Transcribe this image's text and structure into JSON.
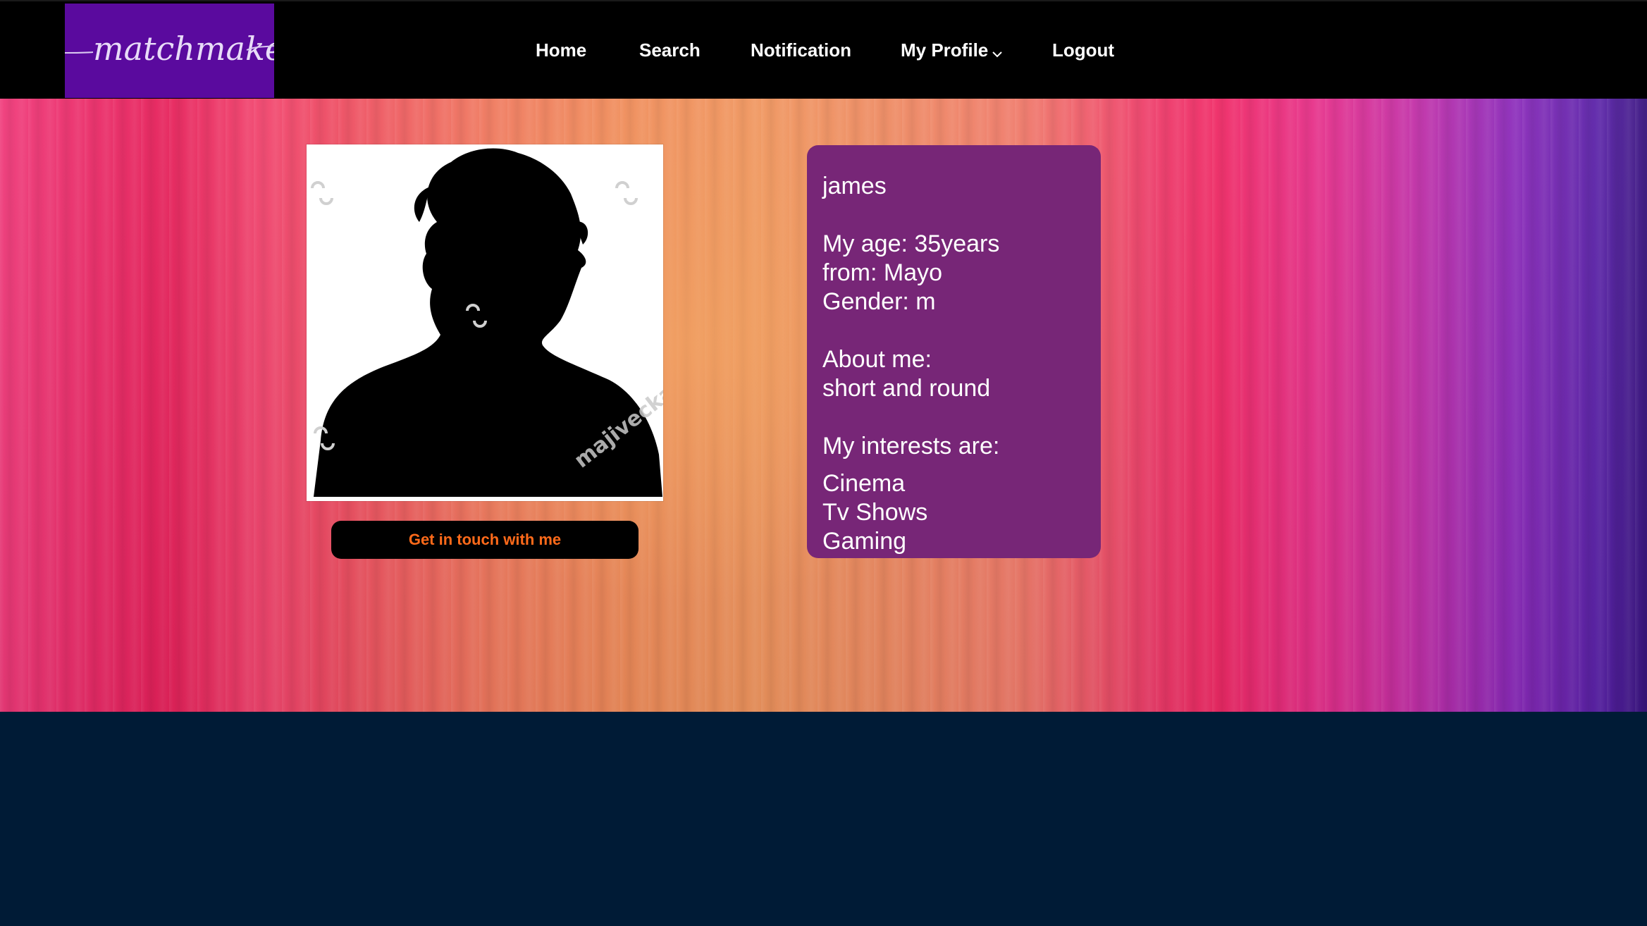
{
  "header": {
    "logo_text": "matchmaker",
    "nav": [
      {
        "label": "Home"
      },
      {
        "label": "Search"
      },
      {
        "label": "Notification"
      },
      {
        "label": "My Profile"
      },
      {
        "label": "Logout"
      }
    ]
  },
  "profile": {
    "photo_watermark": "majivecka",
    "contact_button": "Get in touch with me",
    "name": "james",
    "age": "My age: 35years",
    "from": "from: Mayo",
    "gender": "Gender: m",
    "about_label": "About me:",
    "about_text": "short and round",
    "interests_label": "My interests are:",
    "interests": [
      "Cinema",
      "Tv Shows",
      "Gaming"
    ]
  },
  "colors": {
    "header_bg": "#000000",
    "logo_bg": "#5a0a9e",
    "card_bg": "#772677",
    "button_text": "#ff6a1a",
    "footer_bg": "#001b36"
  },
  "icons": {
    "dropdown": "chevron-down-icon",
    "avatar": "person-silhouette-icon"
  }
}
